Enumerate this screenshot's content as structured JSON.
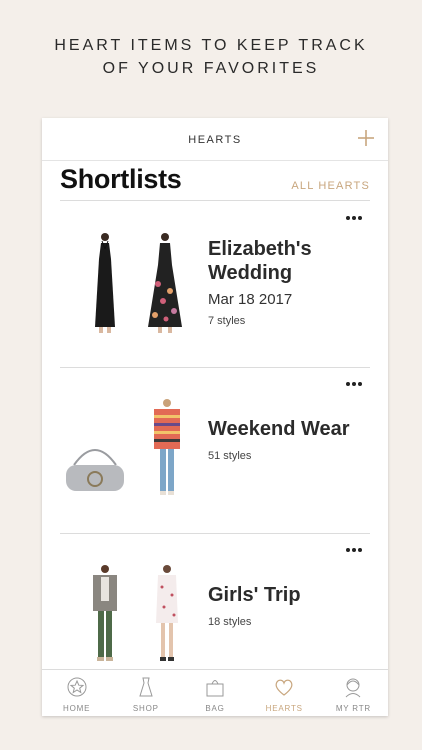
{
  "promo": {
    "line1": "HEART ITEMS TO KEEP TRACK",
    "line2": "OF YOUR FAVORITES"
  },
  "navbar": {
    "title": "HEARTS",
    "add_icon": "plus-icon"
  },
  "section": {
    "title": "Shortlists",
    "all_hearts_label": "ALL HEARTS"
  },
  "shortlists": [
    {
      "title": "Elizabeth's Wedding",
      "date": "Mar 18 2017",
      "count": "7 styles",
      "thumbs": [
        "black-halter-gown",
        "floral-print-gown"
      ]
    },
    {
      "title": "Weekend Wear",
      "date": "",
      "count": "51 styles",
      "thumbs": [
        "grey-handbag",
        "striped-coat-jeans"
      ]
    },
    {
      "title": "Girls' Trip",
      "date": "",
      "count": "18 styles",
      "thumbs": [
        "blazer-green-pants",
        "printed-shift-dress"
      ]
    }
  ],
  "tabs": [
    {
      "label": "HOME",
      "icon": "star-circle-icon",
      "active": false
    },
    {
      "label": "SHOP",
      "icon": "dress-icon",
      "active": false
    },
    {
      "label": "BAG",
      "icon": "bag-icon",
      "active": false
    },
    {
      "label": "HEARTS",
      "icon": "heart-icon",
      "active": true
    },
    {
      "label": "MY RTR",
      "icon": "profile-icon",
      "active": false
    }
  ],
  "colors": {
    "accent": "#c8a67e",
    "background": "#f4efea",
    "text": "#111111"
  }
}
